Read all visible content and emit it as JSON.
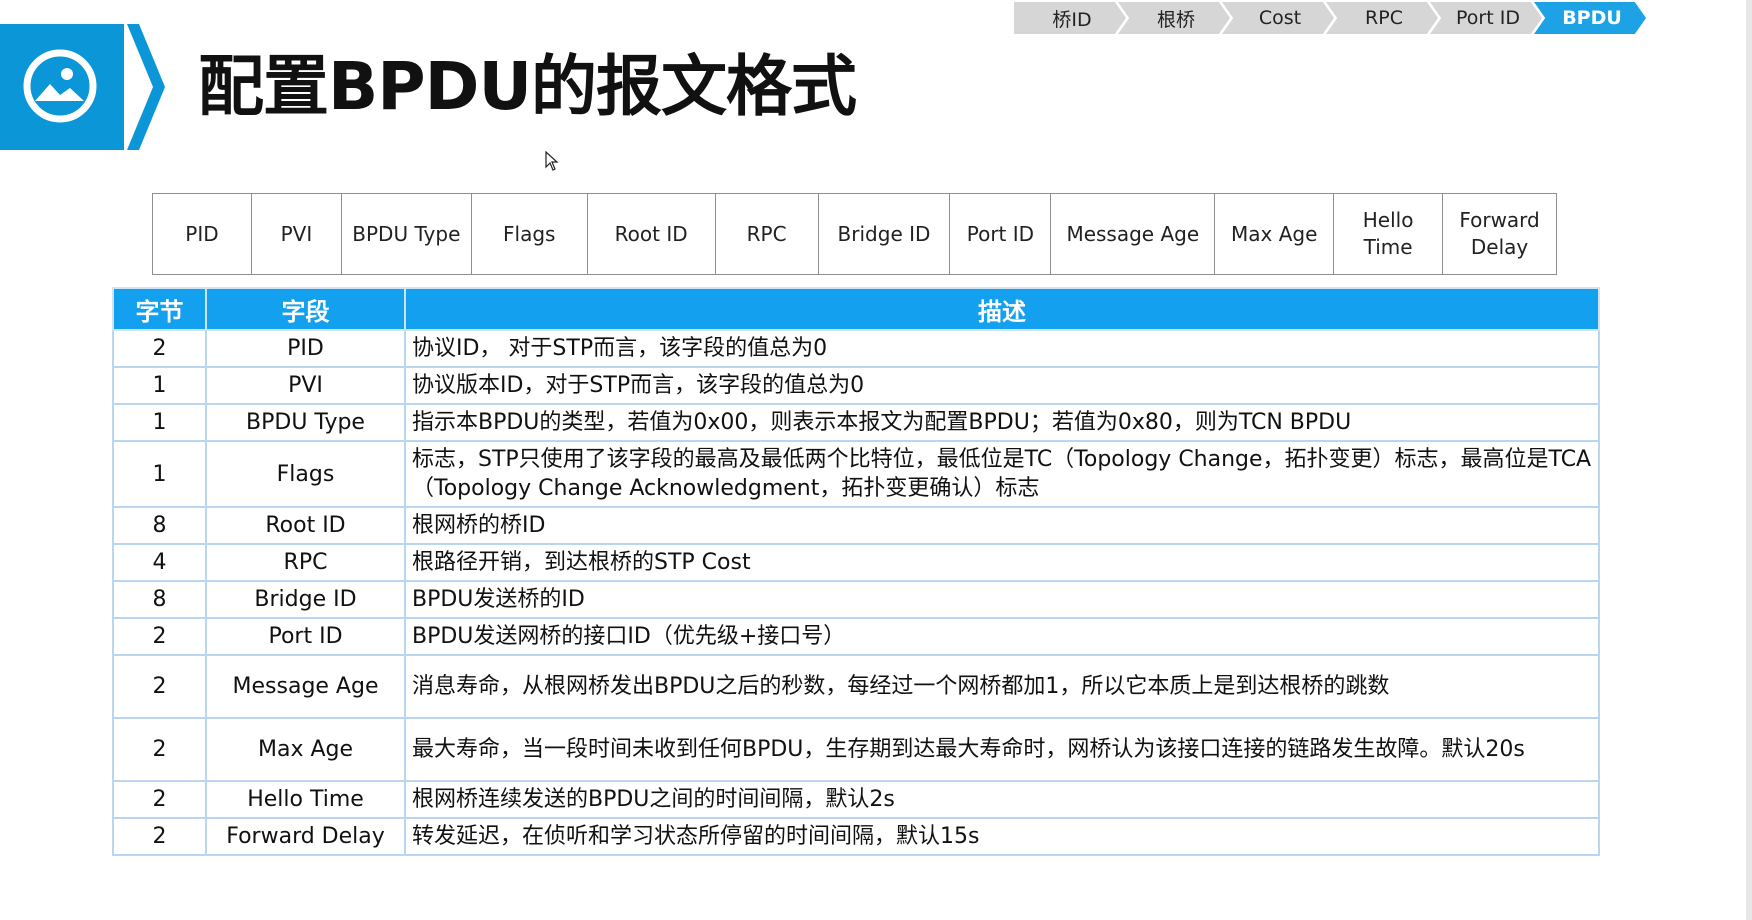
{
  "title": "配置BPDU的报文格式",
  "breadcrumb": [
    {
      "label": "桥ID",
      "active": false
    },
    {
      "label": "根桥",
      "active": false
    },
    {
      "label": "Cost",
      "active": false
    },
    {
      "label": "RPC",
      "active": false
    },
    {
      "label": "Port ID",
      "active": false
    },
    {
      "label": "BPDU",
      "active": true
    }
  ],
  "colors": {
    "accent": "#0b96d8",
    "header_fill": "#12a0ef",
    "active_crumb": "#1ea2e6",
    "inactive_crumb": "#d6d6d6"
  },
  "icons": {
    "header_icon": "image-icon",
    "cursor": "mouse-pointer-icon"
  },
  "fields": [
    "PID",
    "PVI",
    "BPDU Type",
    "Flags",
    "Root ID",
    "RPC",
    "Bridge ID",
    "Port ID",
    "Message Age",
    "Max Age",
    "Hello Time",
    "Forward Delay"
  ],
  "table": {
    "headers": {
      "byte": "字节",
      "field": "字段",
      "desc": "描述"
    },
    "rows": [
      {
        "byte": "2",
        "field": "PID",
        "desc": "协议ID， 对于STP而言，该字段的值总为0"
      },
      {
        "byte": "1",
        "field": "PVI",
        "desc": "协议版本ID，对于STP而言，该字段的值总为0"
      },
      {
        "byte": "1",
        "field": "BPDU Type",
        "desc": "指示本BPDU的类型，若值为0x00，则表示本报文为配置BPDU；若值为0x80，则为TCN BPDU"
      },
      {
        "byte": "1",
        "field": "Flags",
        "desc": "标志，STP只使用了该字段的最高及最低两个比特位，最低位是TC（Topology Change，拓扑变更）标志，最高位是TCA（Topology Change Acknowledgment，拓扑变更确认）标志"
      },
      {
        "byte": "8",
        "field": "Root ID",
        "desc": "根网桥的桥ID"
      },
      {
        "byte": "4",
        "field": "RPC",
        "desc": "根路径开销，到达根桥的STP Cost"
      },
      {
        "byte": "8",
        "field": "Bridge ID",
        "desc": "BPDU发送桥的ID"
      },
      {
        "byte": "2",
        "field": "Port ID",
        "desc": "BPDU发送网桥的接口ID（优先级+接口号）"
      },
      {
        "byte": "2",
        "field": "Message Age",
        "desc": "消息寿命，从根网桥发出BPDU之后的秒数，每经过一个网桥都加1，所以它本质上是到达根桥的跳数"
      },
      {
        "byte": "2",
        "field": "Max Age",
        "desc": "最大寿命，当一段时间未收到任何BPDU，生存期到达最大寿命时，网桥认为该接口连接的链路发生故障。默认20s"
      },
      {
        "byte": "2",
        "field": "Hello Time",
        "desc": "根网桥连续发送的BPDU之间的时间间隔，默认2s"
      },
      {
        "byte": "2",
        "field": "Forward Delay",
        "desc": "转发延迟，在侦听和学习状态所停留的时间间隔，默认15s"
      }
    ]
  }
}
